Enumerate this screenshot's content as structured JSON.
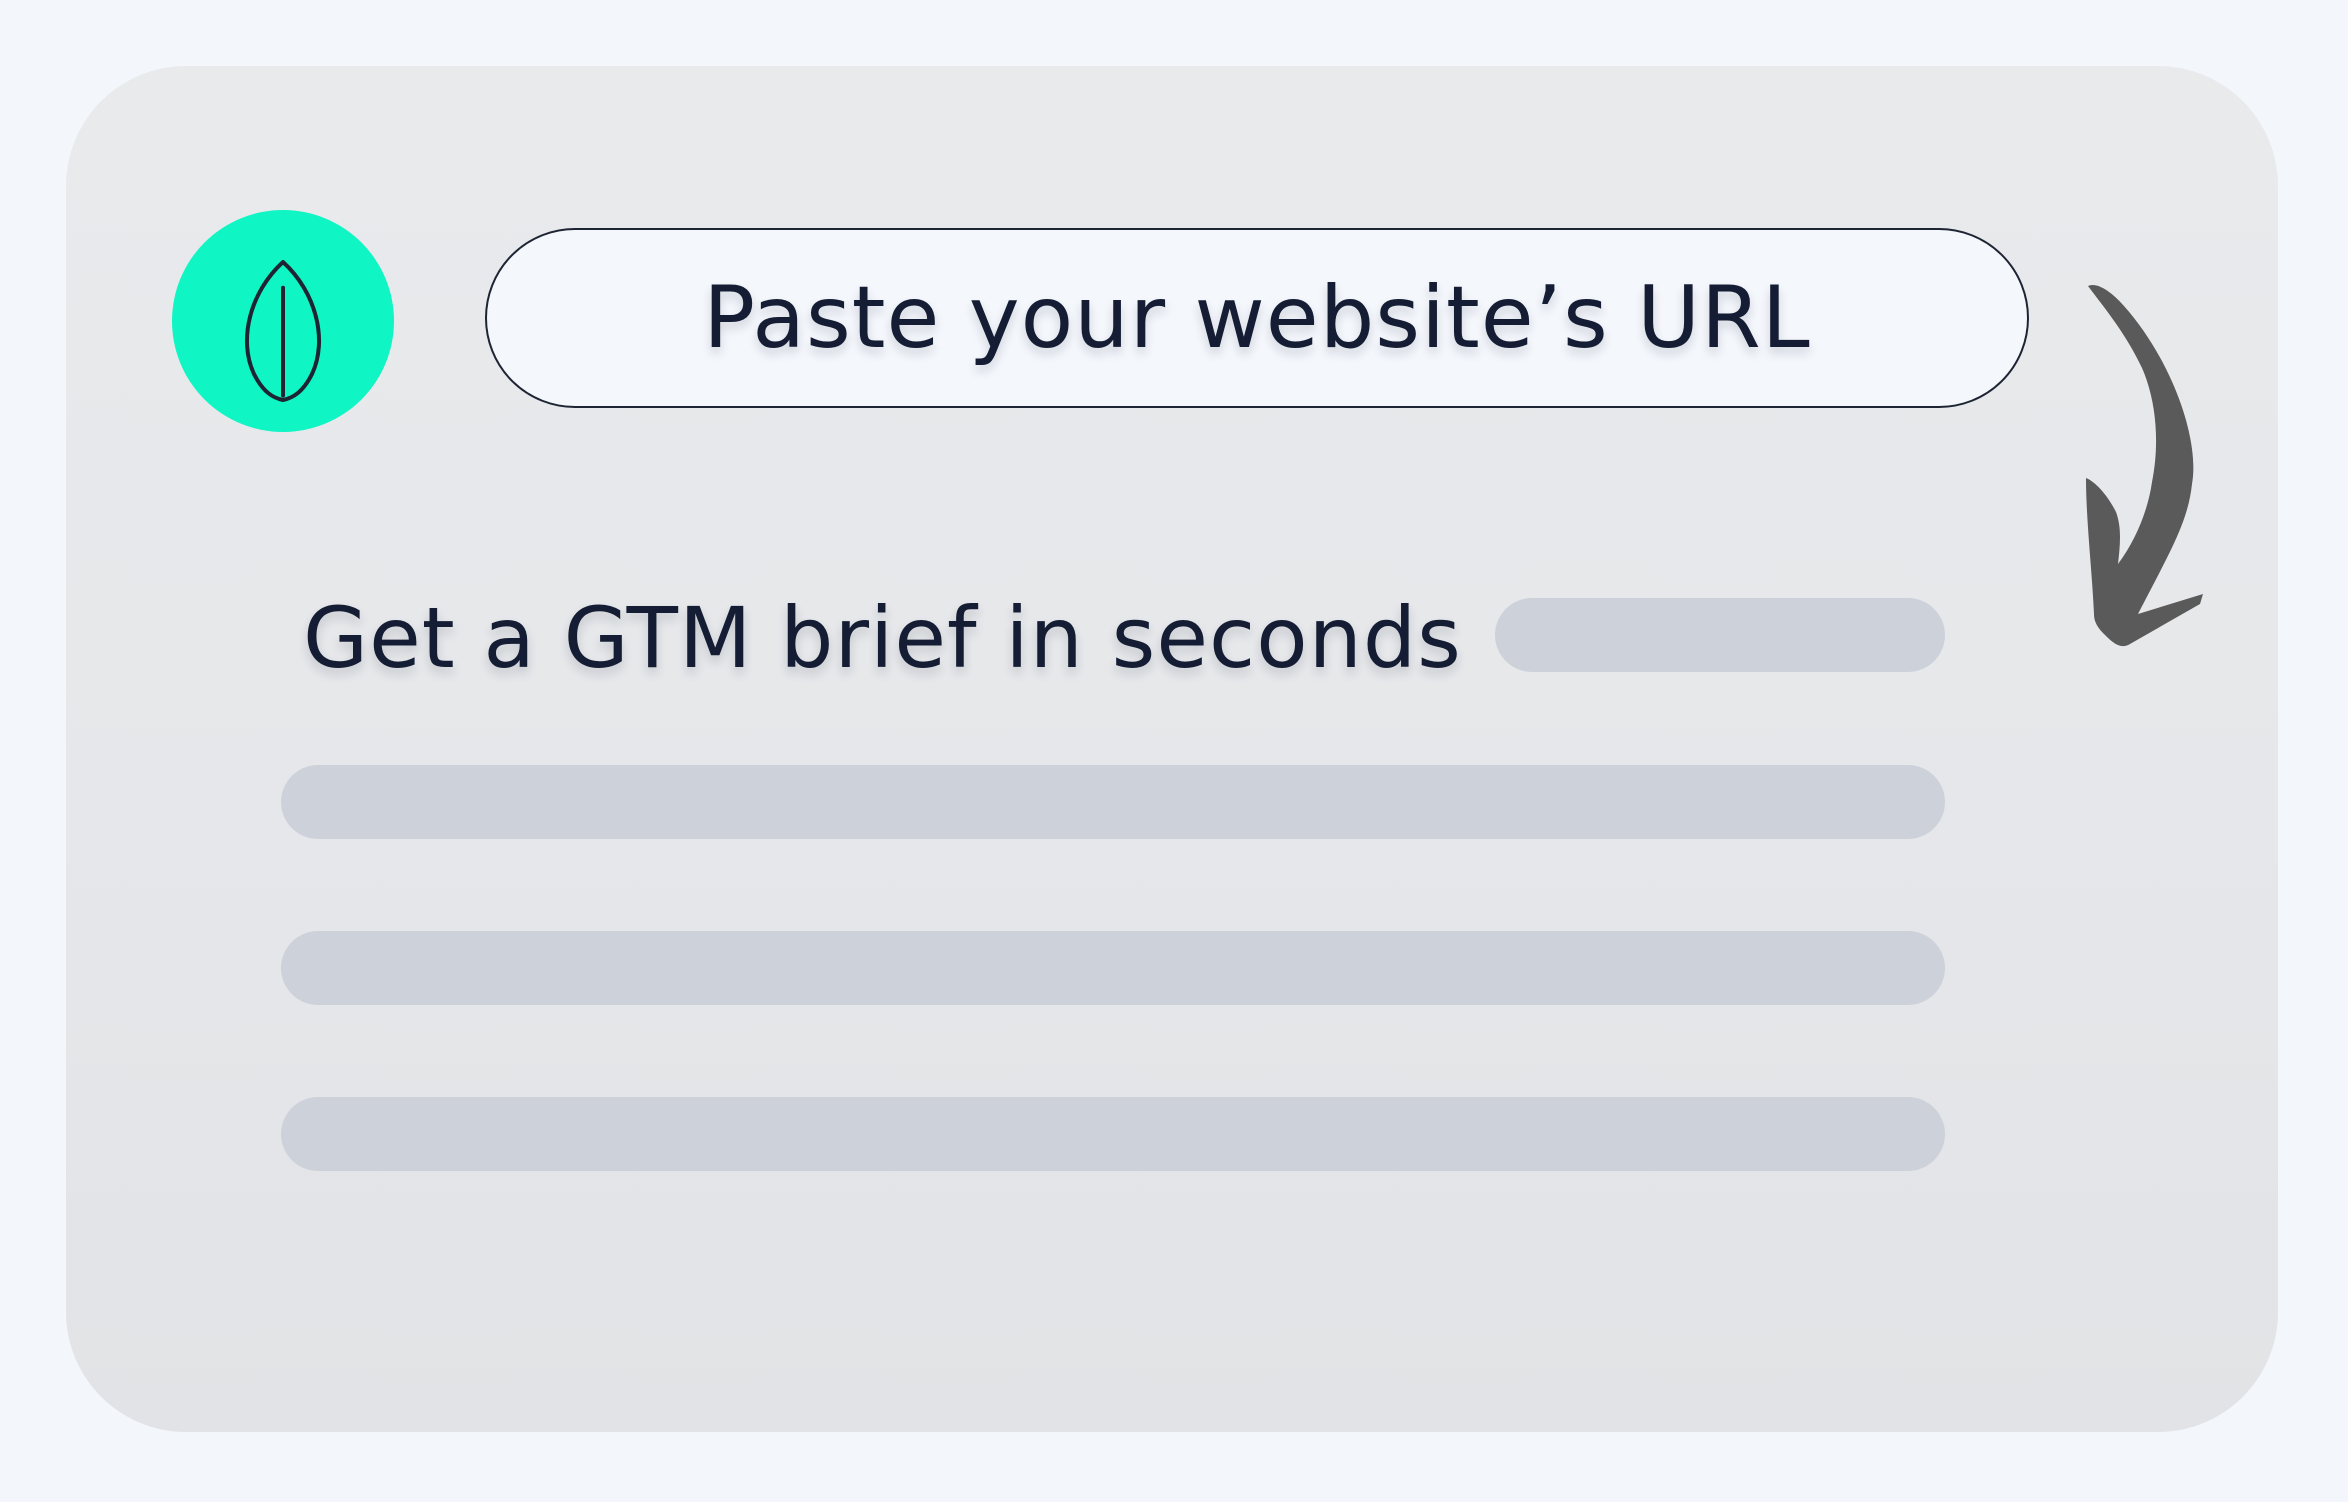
{
  "brand": {
    "logo_icon": "leaf-icon",
    "accent_color": "#0ff5c4"
  },
  "url_input": {
    "placeholder": "Paste your website’s URL"
  },
  "arrow_icon": "curved-arrow-down-icon",
  "brief": {
    "title": "Get a GTM brief in seconds"
  },
  "colors": {
    "background": "#f3f6fb",
    "card": "#e8e9eb",
    "text": "#141d33",
    "placeholder_bar": "#cdd1da",
    "arrow": "#5a5a5a"
  }
}
